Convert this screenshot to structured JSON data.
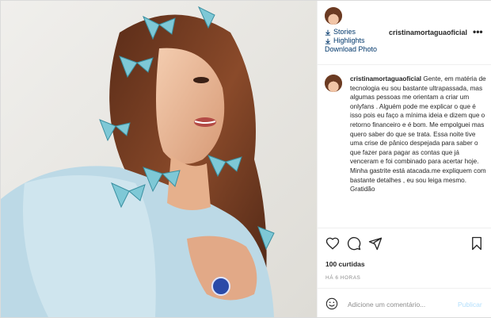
{
  "header": {
    "stories": "Stories",
    "highlights": "Highlights",
    "download": "Download Photo",
    "username": "cristinamortaguaoficial",
    "more": "•••"
  },
  "caption": {
    "username": "cristinamortaguaoficial",
    "text": "Gente, em matéria de tecnologia eu sou bastante ultrapassada, mas algumas pessoas me orientam a criar um onlyfans . Alguém pode me explicar o que é isso pois eu faço a mínima ideia e dizem que o retorno financeiro e é bom. Me empolguei mas quero saber do que se trata. Essa noite tive uma crise de pânico despejada para saber o que fazer para pagar as contas que já venceram e foi combinado para acertar hoje. Minha gastrite está atacada.me expliquem com bastante detalhes , eu sou leiga mesmo. Gratidão"
  },
  "actions": {
    "likes": "100 curtidas",
    "time": "HÁ 6 HORAS"
  },
  "add_comment": {
    "placeholder": "Adicione um comentário...",
    "publish": "Publicar"
  },
  "icons": [
    "like-heart-icon",
    "comment-icon",
    "share-icon",
    "save-bookmark-icon",
    "smile-icon",
    "stories-icon",
    "highlights-icon",
    "more-icon"
  ],
  "colors": {
    "link": "#00376b",
    "publish": "#b2dffc",
    "muted": "#8e8e8e",
    "border": "#dbdbdb"
  }
}
